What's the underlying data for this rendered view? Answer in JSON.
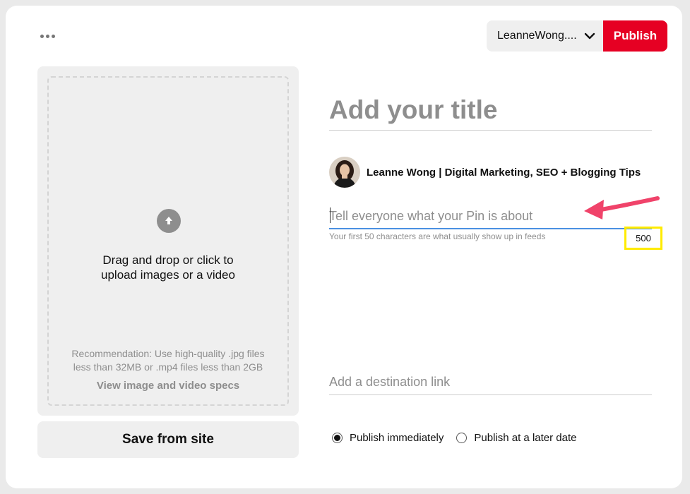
{
  "header": {
    "more_icon": "ellipsis-icon",
    "board_name": "LeanneWong....",
    "publish_label": "Publish"
  },
  "upload": {
    "icon": "upload-arrow-icon",
    "prompt_line1": "Drag and drop or click to",
    "prompt_line2": "upload images or a video",
    "recommendation_line1": "Recommendation: Use high-quality .jpg files",
    "recommendation_line2": "less than 32MB or .mp4 files less than 2GB",
    "specs_link": "View image and video specs"
  },
  "save_from_site_label": "Save from site",
  "form": {
    "title_placeholder": "Add your title",
    "author_name": "Leanne Wong | Digital Marketing, SEO + Blogging Tips",
    "description_placeholder": "Tell everyone what your Pin is about",
    "description_helper": "Your first 50 characters are what usually show up in feeds",
    "char_count": "500",
    "link_placeholder": "Add a destination link"
  },
  "publish_options": [
    {
      "label": "Publish immediately",
      "checked": true
    },
    {
      "label": "Publish at a later date",
      "checked": false
    }
  ],
  "colors": {
    "brand_red": "#e60023",
    "focus_blue": "#4a90e2",
    "annotation_pink": "#f0436a",
    "annotation_yellow": "#ffeb00"
  }
}
